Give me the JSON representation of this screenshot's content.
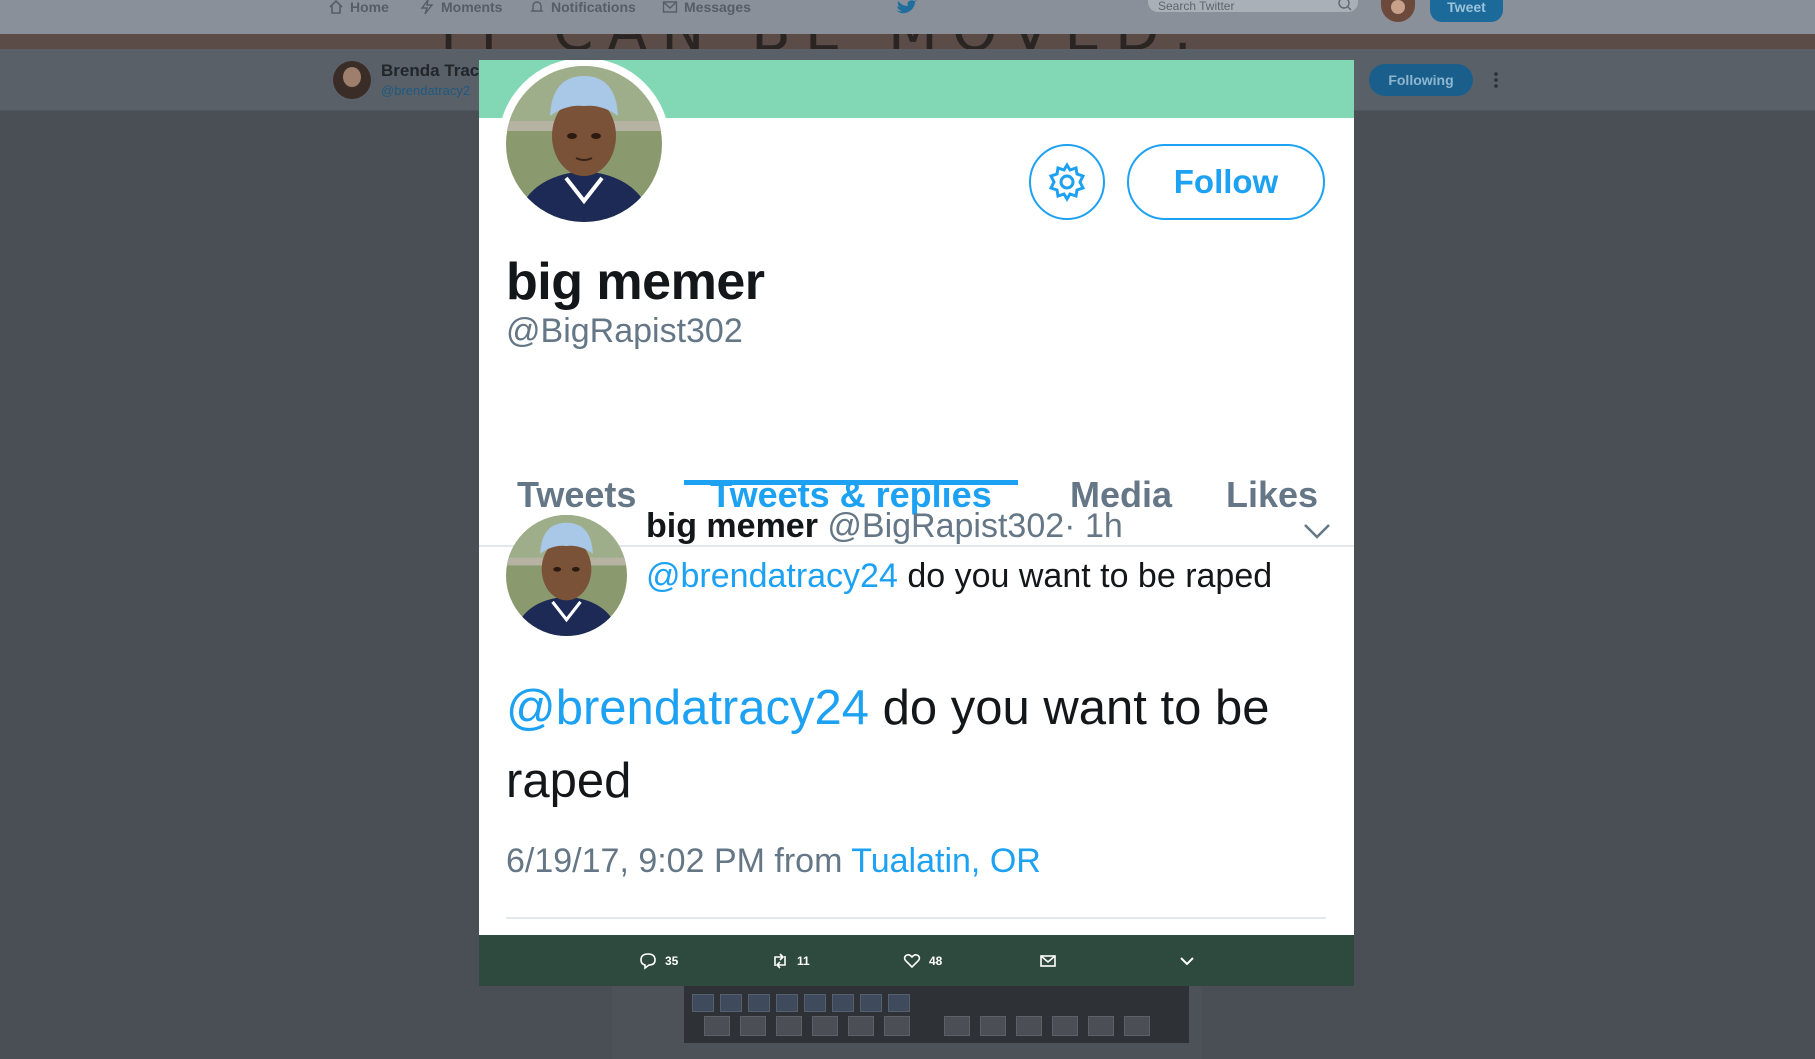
{
  "topnav": {
    "home_label": "Home",
    "moments_label": "Moments",
    "notifications_label": "Notifications",
    "messages_label": "Messages",
    "search_placeholder": "Search Twitter",
    "tweet_button": "Tweet"
  },
  "banner": {
    "text": "IT CAN BE MOVED."
  },
  "profile_bar": {
    "name": "Brenda Trac",
    "handle": "@brendatracy2",
    "following_button": "Following"
  },
  "modal": {
    "follow_button": "Follow",
    "display_name": "big memer",
    "handle": "@BigRapist302",
    "tabs": [
      {
        "label": "Tweets"
      },
      {
        "label": "Tweets & replies",
        "active": true
      },
      {
        "label": "Media"
      },
      {
        "label": "Likes"
      }
    ],
    "tweet": {
      "name": "big memer",
      "handle": "@BigRapist302",
      "time": "· 1h",
      "mention": "@brendatracy24",
      "text": " do you want to be raped"
    },
    "detail": {
      "mention": "@brendatracy24",
      "text": " do you want to be raped",
      "timestamp": "6/19/17, 9:02 PM from ",
      "location": "Tualatin, OR"
    }
  },
  "actions": {
    "replies": "35",
    "retweets": "11",
    "likes": "48"
  },
  "colors": {
    "accent": "#1da1f2",
    "header_band": "#82d7b5",
    "action_bar": "#2e4a3f"
  }
}
